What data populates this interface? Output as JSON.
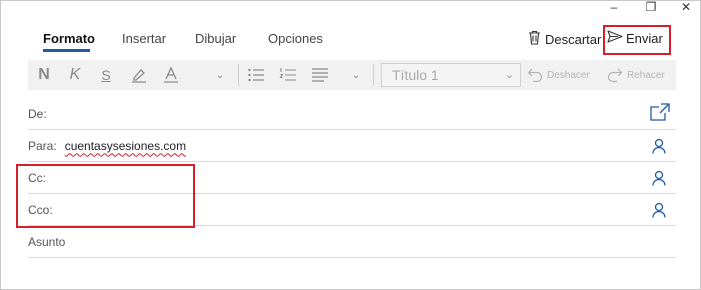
{
  "window": {
    "minimize": "–",
    "maximize": "❐",
    "close": "✕"
  },
  "tabs": [
    {
      "label": "Formato",
      "active": true
    },
    {
      "label": "Insertar"
    },
    {
      "label": "Dibujar"
    },
    {
      "label": "Opciones"
    }
  ],
  "actions": {
    "discard_label": "Descartar",
    "send_label": "Enviar"
  },
  "toolbar": {
    "bold": "N",
    "italic": "K",
    "underline": "S",
    "style_value": "Título 1",
    "undo_label": "Deshacer",
    "redo_label": "Rehacer"
  },
  "fields": {
    "from_label": "De:",
    "to_label": "Para:",
    "to_value": "cuentasysesiones.com",
    "cc_label": "Cc:",
    "bcc_label": "Cco:",
    "subject_placeholder": "Asunto"
  },
  "colors": {
    "accent": "#1e5aa8",
    "highlight": "#d4202a",
    "toolbar_bg": "#f1f1f1"
  }
}
